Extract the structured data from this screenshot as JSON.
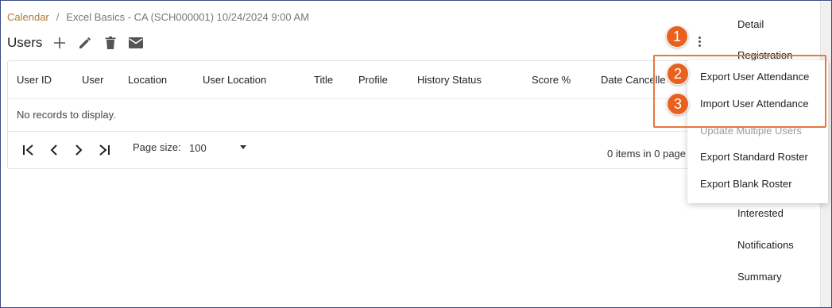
{
  "breadcrumb": {
    "root": "Calendar",
    "separator": "/",
    "current": "Excel Basics - CA (SCH000001) 10/24/2024 9:00 AM"
  },
  "header": {
    "title": "Users",
    "icons": [
      "plus-icon",
      "pencil-icon",
      "trash-icon",
      "envelope-icon"
    ]
  },
  "grid": {
    "columns": [
      "User ID",
      "User",
      "Location",
      "User Location",
      "Title",
      "Profile",
      "History Status",
      "Score %",
      "Date Cancelle"
    ],
    "empty_message": "No records to display.",
    "pager": {
      "first_icon": "first-page-icon",
      "prev_icon": "prev-page-icon",
      "next_icon": "next-page-icon",
      "last_icon": "last-page-icon",
      "page_size_label": "Page size:",
      "page_size_value": "100",
      "items_info": "0 items in 0 page"
    }
  },
  "side_panel": {
    "items": [
      "Detail",
      "Registration",
      "Interested",
      "Notifications",
      "Summary"
    ]
  },
  "menu": {
    "items": [
      "Export User Attendance",
      "Import User Attendance",
      "Update Multiple Users",
      "Export Standard Roster",
      "Export Blank Roster"
    ]
  },
  "callouts": [
    "1",
    "2",
    "3"
  ],
  "colors": {
    "accent_link": "#b07a3c",
    "callout": "#e8611f",
    "highlight": "#e8773a",
    "frame_border": "#3a4a8a"
  }
}
